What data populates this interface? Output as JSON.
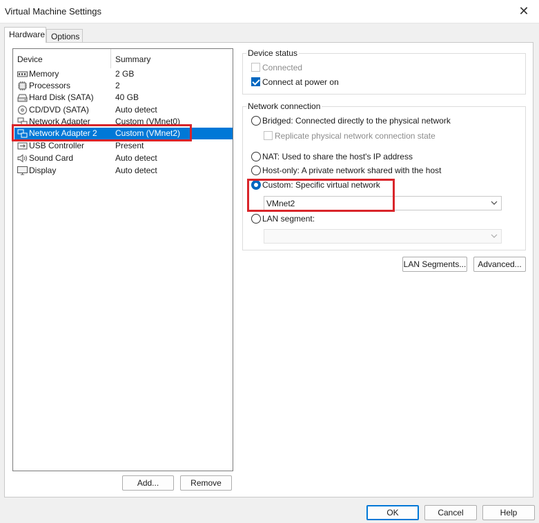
{
  "window": {
    "title": "Virtual Machine Settings",
    "close_glyph": "✕"
  },
  "tabs": [
    {
      "label": "Hardware"
    },
    {
      "label": "Options"
    }
  ],
  "device_list": {
    "col_device": "Device",
    "col_summary": "Summary",
    "rows": [
      {
        "device": "Memory",
        "summary": "2 GB",
        "icon": "memory-icon"
      },
      {
        "device": "Processors",
        "summary": "2",
        "icon": "processor-icon"
      },
      {
        "device": "Hard Disk (SATA)",
        "summary": "40 GB",
        "icon": "hard-disk-icon"
      },
      {
        "device": "CD/DVD (SATA)",
        "summary": "Auto detect",
        "icon": "cd-dvd-icon"
      },
      {
        "device": "Network Adapter",
        "summary": "Custom (VMnet0)",
        "icon": "network-adapter-icon"
      },
      {
        "device": "Network Adapter 2",
        "summary": "Custom (VMnet2)",
        "icon": "network-adapter-icon"
      },
      {
        "device": "USB Controller",
        "summary": "Present",
        "icon": "usb-icon"
      },
      {
        "device": "Sound Card",
        "summary": "Auto detect",
        "icon": "sound-card-icon"
      },
      {
        "device": "Display",
        "summary": "Auto detect",
        "icon": "display-icon"
      }
    ],
    "selected_index": 5
  },
  "list_buttons": {
    "add": "Add...",
    "remove": "Remove"
  },
  "device_status": {
    "label": "Device status",
    "connected": "Connected",
    "connect_at_power_on": "Connect at power on"
  },
  "network_connection": {
    "label": "Network connection",
    "bridged": "Bridged: Connected directly to the physical network",
    "replicate": "Replicate physical network connection state",
    "nat": "NAT: Used to share the host's IP address",
    "host_only": "Host-only: A private network shared with the host",
    "custom": "Custom: Specific virtual network",
    "custom_value": "VMnet2",
    "lan_segment": "LAN segment:",
    "lan_segment_value": ""
  },
  "panel_buttons": {
    "lan_segments": "LAN Segments...",
    "advanced": "Advanced..."
  },
  "dialog_buttons": {
    "ok": "OK",
    "cancel": "Cancel",
    "help": "Help"
  },
  "colors": {
    "accent": "#0078d7",
    "highlight_border": "#d9252a",
    "selection": "#0078d7"
  }
}
